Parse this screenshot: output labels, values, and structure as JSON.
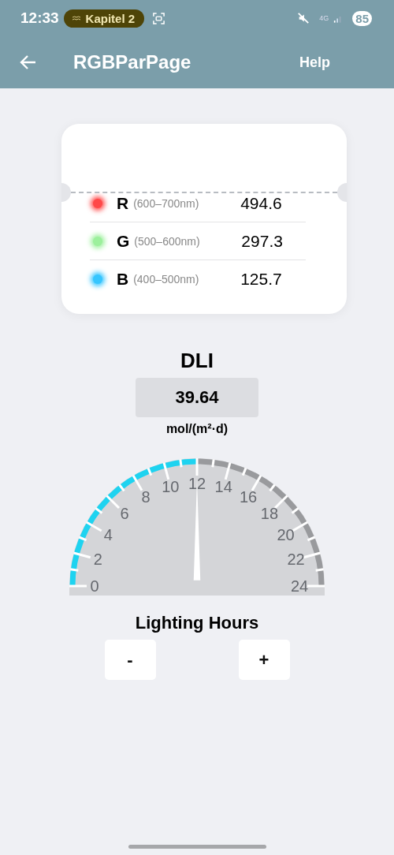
{
  "status_bar": {
    "time": "12:33",
    "media_pill": "Kapitel 2",
    "network": "4G",
    "battery": "85"
  },
  "app_bar": {
    "title": "RGBParPage",
    "action": "Help"
  },
  "channels": [
    {
      "letter": "R",
      "range": "(600–700nm)",
      "value": "494.6",
      "color": "#ff4848"
    },
    {
      "letter": "G",
      "range": "(500–600nm)",
      "value": "297.3",
      "color": "#9cf09c"
    },
    {
      "letter": "B",
      "range": "(400–500nm)",
      "value": "125.7",
      "color": "#36c6ff"
    }
  ],
  "dli": {
    "title": "DLI",
    "value": "39.64",
    "unit": "mol/(m²·d)"
  },
  "gauge": {
    "scale_labels": [
      "0",
      "2",
      "4",
      "6",
      "8",
      "10",
      "12",
      "14",
      "16",
      "18",
      "20",
      "22",
      "24"
    ]
  },
  "lighting_hours": {
    "title": "Lighting Hours",
    "buttons": [
      "-",
      "+"
    ]
  }
}
